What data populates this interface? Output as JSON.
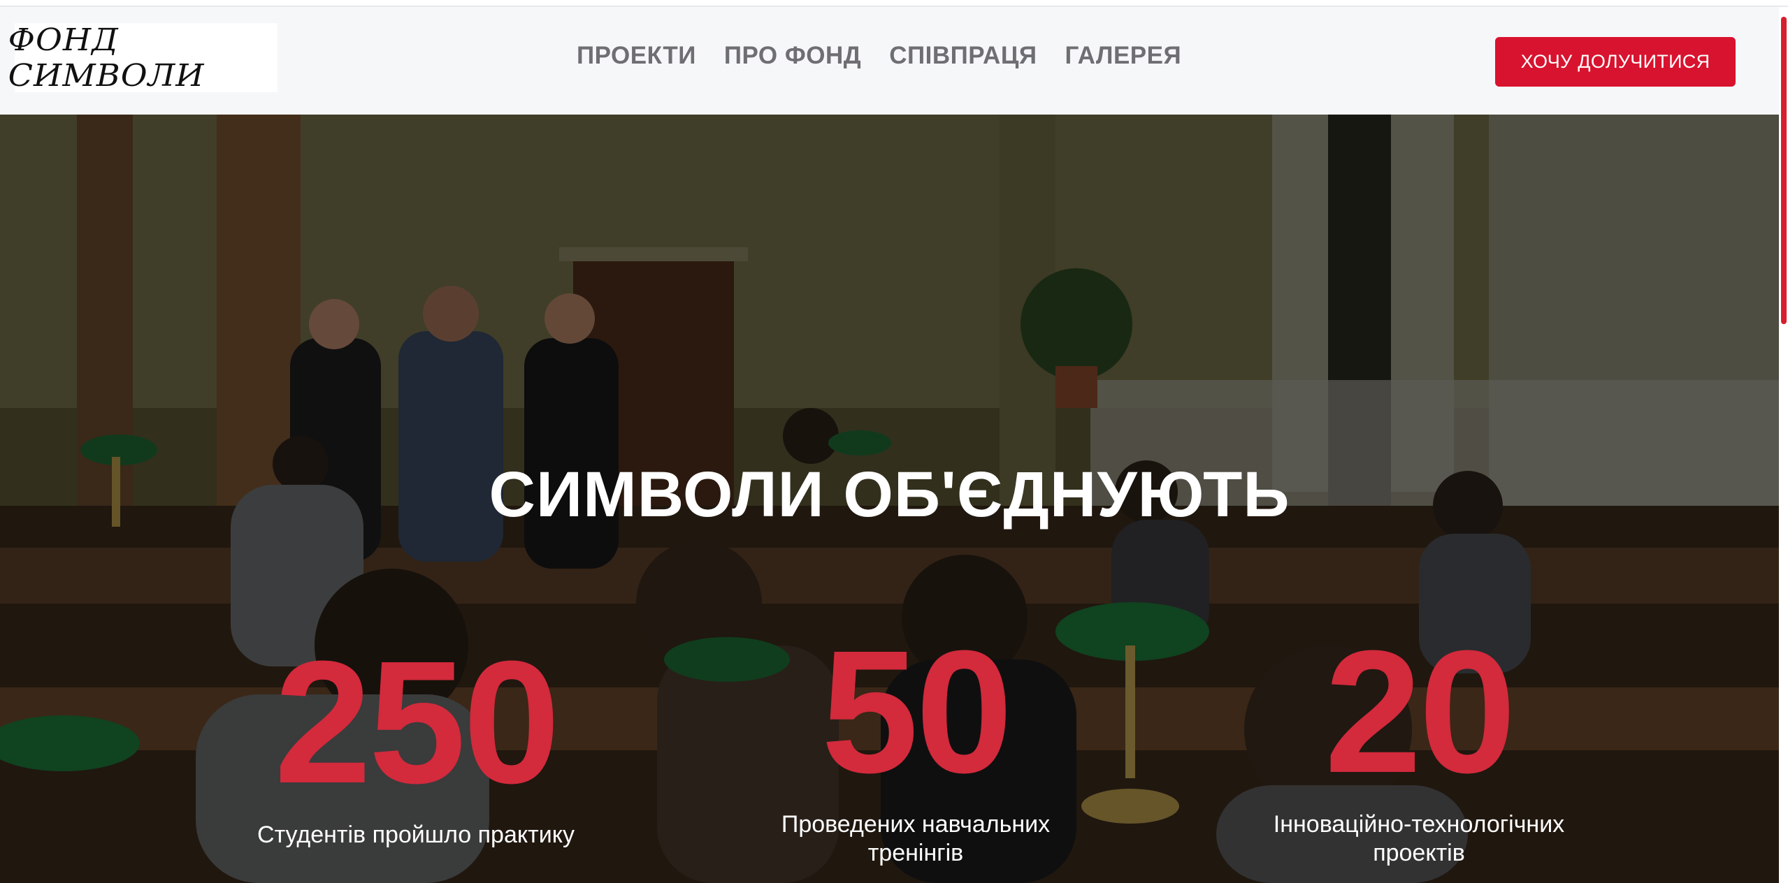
{
  "header": {
    "logo_text": "ФОНД СИМВОЛИ",
    "nav": [
      {
        "label": "ПРОЕКТИ"
      },
      {
        "label": "ПРО ФОНД"
      },
      {
        "label": "СПІВПРАЦЯ"
      },
      {
        "label": "ГАЛЕРЕЯ"
      }
    ],
    "cta_label": "ХОЧУ ДОЛУЧИТИСЯ"
  },
  "hero": {
    "title": "СИМВОЛИ ОБ'ЄДНУЮТЬ",
    "stats": [
      {
        "number": "250",
        "label": "Студентів пройшло практику"
      },
      {
        "number": "50",
        "label_line1": "Проведених навчальних",
        "label_line2": "тренінгів"
      },
      {
        "number": "20",
        "label_line1": "Інноваційно-технологічних",
        "label_line2": "проектів"
      }
    ]
  },
  "colors": {
    "accent": "#d8132f",
    "stat_number": "#d32a3c",
    "nav_text": "#6e6e73",
    "header_bg": "#f6f7f9"
  }
}
